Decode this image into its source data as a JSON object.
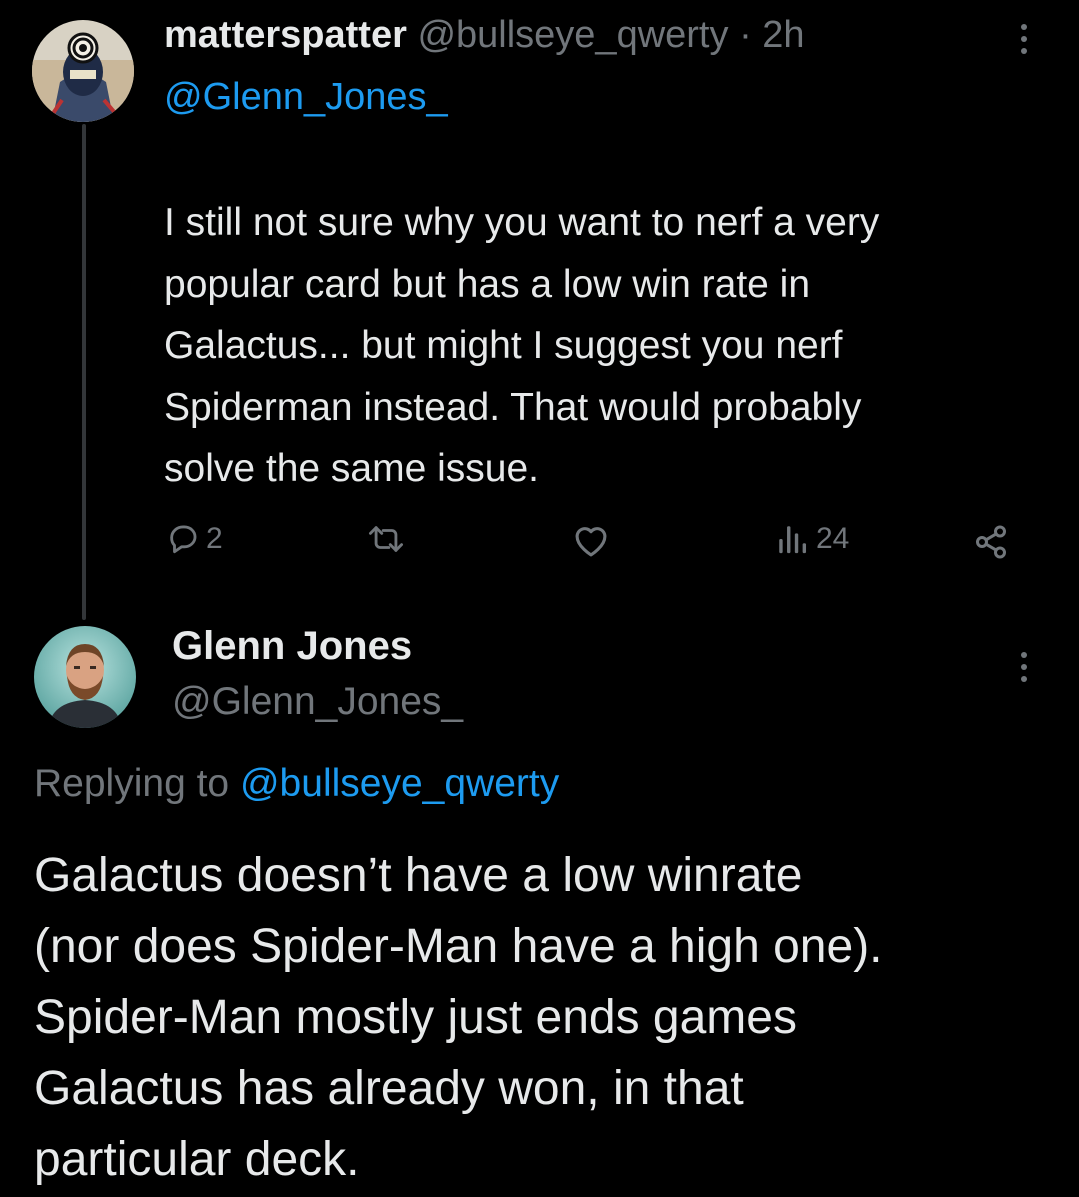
{
  "reply_tweet": {
    "display_name": "matterspatter",
    "handle": "@bullseye_qwerty",
    "separator": "·",
    "time": "2h",
    "mention": "@Glenn_Jones_",
    "text_lines": [
      "I still not sure why you want to nerf a very",
      "popular card but has a low win rate in",
      "Galactus... but might I suggest you nerf",
      "Spiderman instead. That would probably",
      "solve the same issue."
    ],
    "actions": {
      "reply_icon": "speech-bubble-icon",
      "reply_count": "2",
      "repost_icon": "repost-icon",
      "like_icon": "heart-icon",
      "views_icon": "bar-chart-icon",
      "views_count": "24",
      "share_icon": "share-icon"
    }
  },
  "main_tweet": {
    "display_name": "Glenn Jones",
    "handle": "@Glenn_Jones_",
    "replying_prefix": "Replying to",
    "replying_handle": "@bullseye_qwerty",
    "text_lines": [
      "Galactus doesn’t have a low winrate",
      "(nor does Spider-Man have a high one).",
      "Spider-Man mostly just ends games",
      "Galactus has already won, in that",
      "particular deck."
    ]
  },
  "colors": {
    "background": "#000000",
    "text": "#e7e9ea",
    "muted": "#71767b",
    "link": "#1d9bf0",
    "thread_line": "#333639"
  }
}
